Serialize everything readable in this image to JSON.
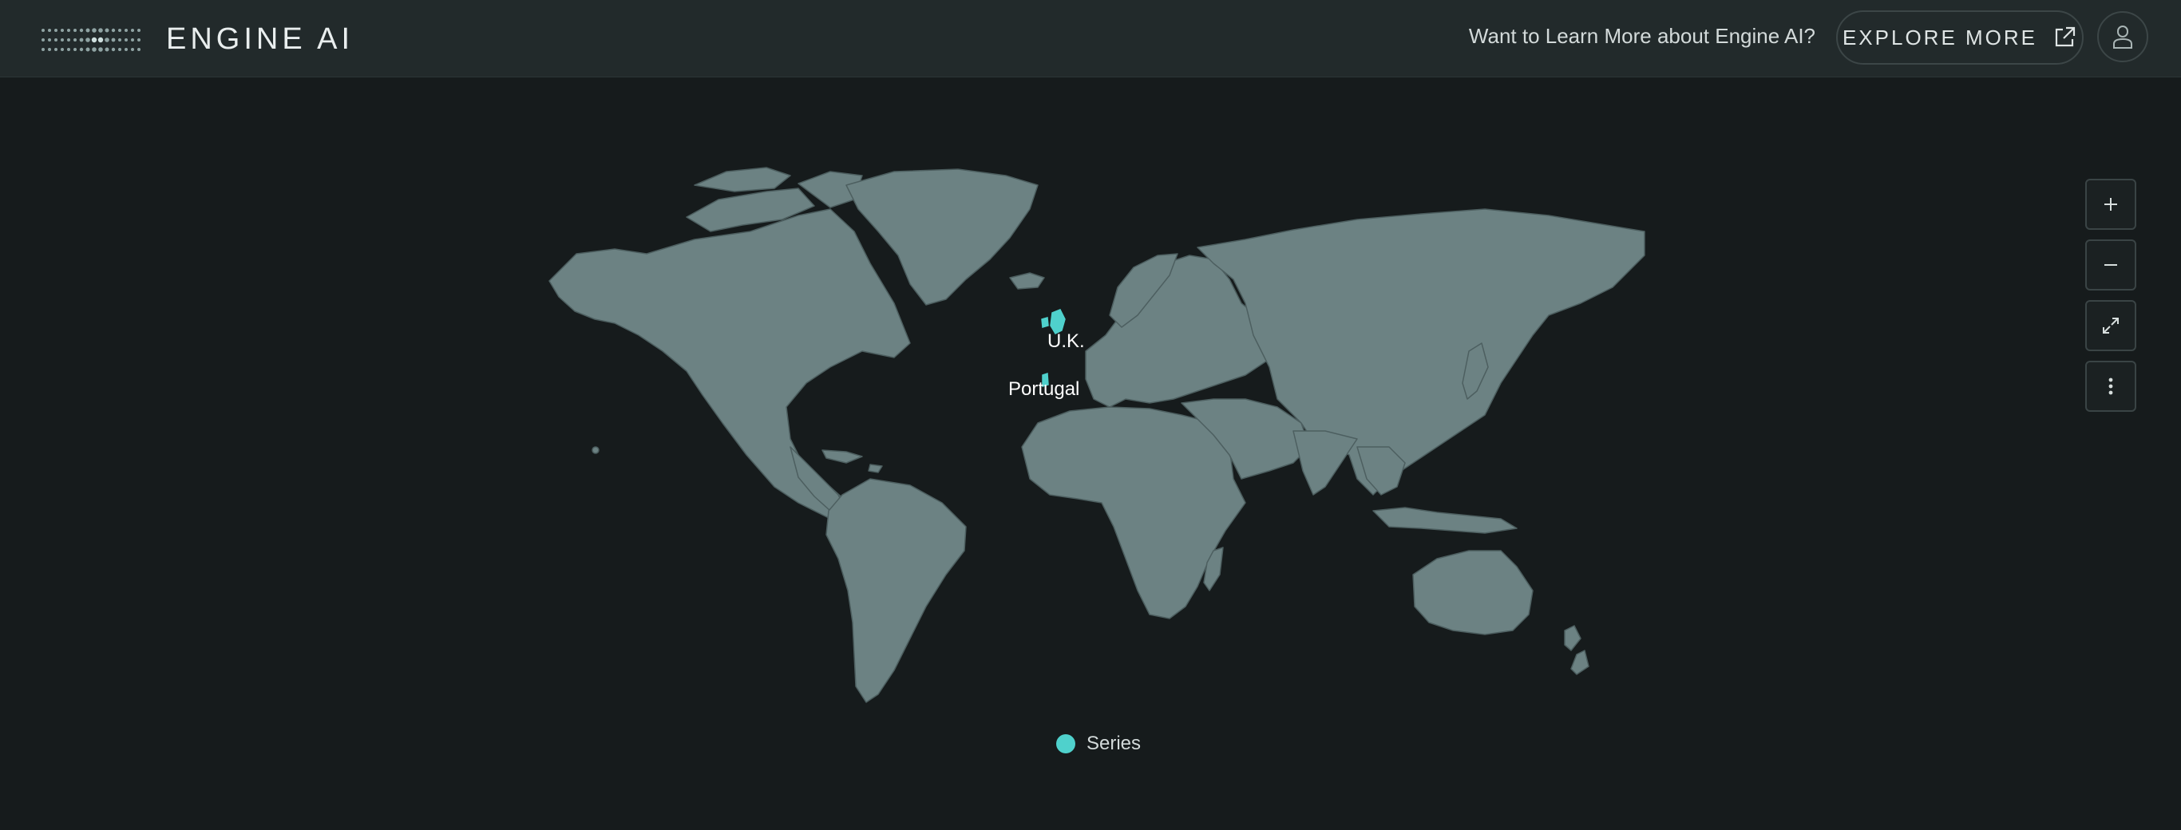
{
  "header": {
    "brand": "ENGINE AI",
    "learn_text": "Want to Learn More about Engine AI?",
    "explore_label": "EXPLORE MORE",
    "icons": {
      "logo": "dot-grid-logo",
      "explore": "external-link-icon",
      "profile": "user-icon"
    }
  },
  "map": {
    "highlight_color": "#4fd1cc",
    "land_color": "#6c8283",
    "labels": [
      {
        "text": "U.K."
      },
      {
        "text": "Portugal"
      }
    ]
  },
  "controls": [
    {
      "name": "zoom-in",
      "icon": "plus-icon"
    },
    {
      "name": "zoom-out",
      "icon": "minus-icon"
    },
    {
      "name": "fullscreen",
      "icon": "expand-icon"
    },
    {
      "name": "more",
      "icon": "vertical-dots-icon"
    }
  ],
  "legend": {
    "label": "Series",
    "color": "#4fd1cc"
  }
}
